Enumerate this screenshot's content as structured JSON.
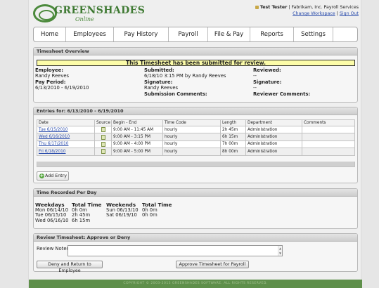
{
  "brand": {
    "name": "GREENSHADES",
    "tagline": "Online"
  },
  "user": {
    "name": "Test Tester",
    "company": "| Fabrikam, Inc. Payroll Services",
    "change_workspace": "Change Workspace",
    "separator": "|",
    "sign_out": "Sign Out"
  },
  "nav": [
    "Home",
    "Employees",
    "Pay History",
    "Payroll",
    "File & Pay",
    "Reports",
    "Settings"
  ],
  "overview": {
    "title": "Timesheet Overview",
    "banner": "This Timesheet has been submitted for review.",
    "employee_label": "Employee:",
    "employee": "Randy Reeves",
    "pay_period_label": "Pay Period:",
    "pay_period": "6/13/2010 - 6/19/2010",
    "submitted_label": "Submitted:",
    "submitted": "6/18/10 3:15 PM by Randy Reeves",
    "signature_label": "Signature:",
    "signature": "Randy Reeves",
    "submission_comments_label": "Submission Comments:",
    "reviewed_label": "Reviewed:",
    "reviewed": "--",
    "reviewer_signature_label": "Signature:",
    "reviewer_signature": "--",
    "reviewer_comments_label": "Reviewer Comments:"
  },
  "entries": {
    "title": "Entries for: 6/13/2010 - 6/19/2010",
    "columns": [
      "Date",
      "Source",
      "Begin - End",
      "Time Code",
      "Length",
      "Department",
      "Comments"
    ],
    "rows": [
      {
        "date": "Tue 6/15/2010",
        "range": "9:00 AM - 11:45 AM",
        "code": "hourly",
        "length": "2h 45m",
        "dept": "Administration",
        "comments": ""
      },
      {
        "date": "Wed 6/16/2010",
        "range": "9:00 AM - 3:15 PM",
        "code": "hourly",
        "length": "6h 15m",
        "dept": "Administration",
        "comments": ""
      },
      {
        "date": "Thu 6/17/2010",
        "range": "9:00 AM - 4:00 PM",
        "code": "hourly",
        "length": "7h 00m",
        "dept": "Administration",
        "comments": ""
      },
      {
        "date": "Fri 6/18/2010",
        "range": "9:00 AM - 5:00 PM",
        "code": "hourly",
        "length": "8h 00m",
        "dept": "Administration",
        "comments": ""
      }
    ],
    "add_entry": "Add Entry"
  },
  "recorded": {
    "title": "Time Recorded Per Day",
    "weekdays_header": "Weekdays",
    "total_header": "Total Time",
    "weekends_header": "Weekends",
    "weekdays": [
      {
        "day": "Mon 06/14/10",
        "time": "0h 0m"
      },
      {
        "day": "Tue 06/15/10",
        "time": "2h 45m"
      },
      {
        "day": "Wed 06/16/10",
        "time": "6h 15m"
      }
    ],
    "weekends": [
      {
        "day": "Sun 06/13/10",
        "time": "0h 0m"
      },
      {
        "day": "Sat 06/19/10",
        "time": "0h 0m"
      }
    ]
  },
  "review": {
    "title": "Review Timesheet: Approve or Deny",
    "notes_label": "Review Notes:",
    "notes_value": "",
    "deny_button": "Deny and Return to Employee",
    "approve_button": "Approve Timesheet for Payroll"
  },
  "footer": "COPYRIGHT © 2003-2013 GREENSHADES SOFTWARE. ALL RIGHTS RESERVED."
}
